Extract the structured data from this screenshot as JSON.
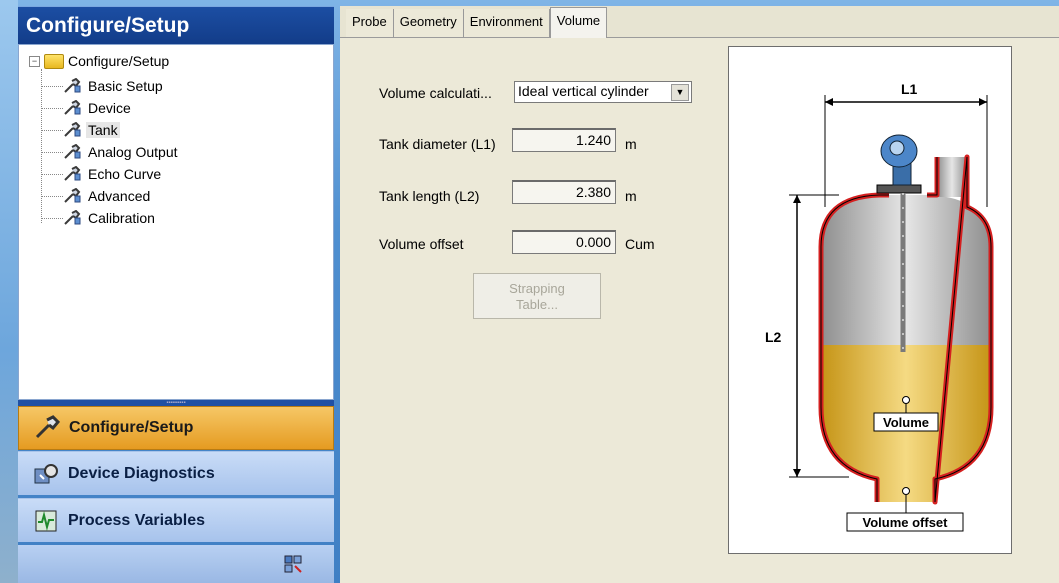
{
  "left_panel": {
    "title": "Configure/Setup",
    "tree": {
      "root": "Configure/Setup",
      "items": [
        {
          "label": "Basic Setup"
        },
        {
          "label": "Device"
        },
        {
          "label": "Tank"
        },
        {
          "label": "Analog Output"
        },
        {
          "label": "Echo Curve"
        },
        {
          "label": "Advanced"
        },
        {
          "label": "Calibration"
        }
      ]
    },
    "nav": {
      "configure": "Configure/Setup",
      "diagnostics": "Device Diagnostics",
      "process": "Process Variables"
    }
  },
  "tabs": [
    "Probe",
    "Geometry",
    "Environment",
    "Volume"
  ],
  "volume_form": {
    "calc_label": "Volume calculati...",
    "calc_value": "Ideal vertical cylinder",
    "diameter_label": "Tank diameter (L1)",
    "diameter_value": "1.240",
    "diameter_unit": "m",
    "length_label": "Tank length (L2)",
    "length_value": "2.380",
    "length_unit": "m",
    "offset_label": "Volume offset",
    "offset_value": "0.000",
    "offset_unit": "Cum",
    "strapping_line1": "Strapping",
    "strapping_line2": "Table..."
  },
  "diagram": {
    "l1_label": "L1",
    "l2_label": "L2",
    "volume_label": "Volume",
    "offset_label": "Volume offset",
    "colors": {
      "wall": "#d42020",
      "liquid": "#e2b83a",
      "gas": "#c4c4c4"
    }
  }
}
